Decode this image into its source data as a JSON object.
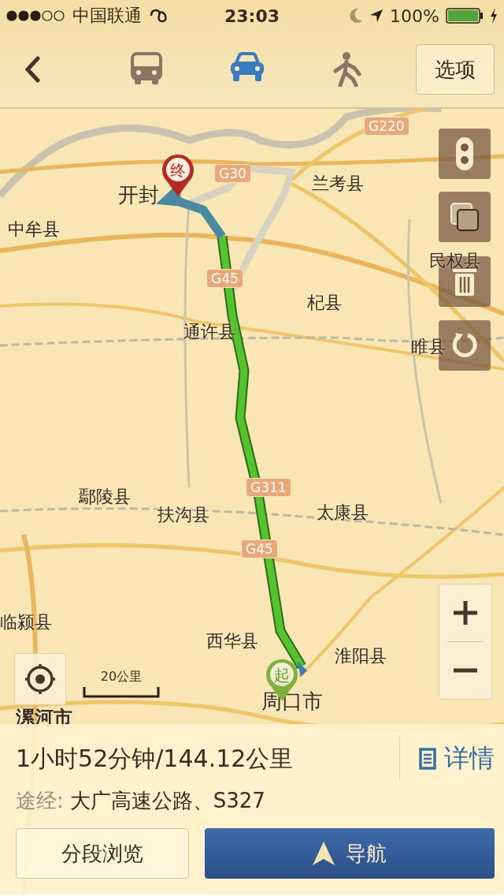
{
  "status_bar": {
    "carrier": "中国联通",
    "time": "23:03",
    "battery": "100%"
  },
  "nav": {
    "tabs": [
      {
        "kind": "bus",
        "selected": false
      },
      {
        "kind": "car",
        "selected": true
      },
      {
        "kind": "walk",
        "selected": false
      }
    ],
    "options_button": "选项"
  },
  "map": {
    "places": [
      "开封",
      "中牟县",
      "兰考县",
      "民权县",
      "杞县",
      "通许县",
      "睢县",
      "鄢陵县",
      "扶沟县",
      "太康县",
      "临颍县",
      "西华县",
      "淮阳县",
      "周口市",
      "漯河市"
    ],
    "road_shields": [
      "G220",
      "G30",
      "G45",
      "G311",
      "G45"
    ],
    "end_pin": "终",
    "start_pin": "起",
    "scale": "20公里"
  },
  "route_panel": {
    "summary": "1小时52分钟/144.12公里",
    "details_link": "详情",
    "via_label": "途经:",
    "via": "大广高速公路、S327",
    "segments_button": "分段浏览",
    "navigate_button": "导航"
  }
}
